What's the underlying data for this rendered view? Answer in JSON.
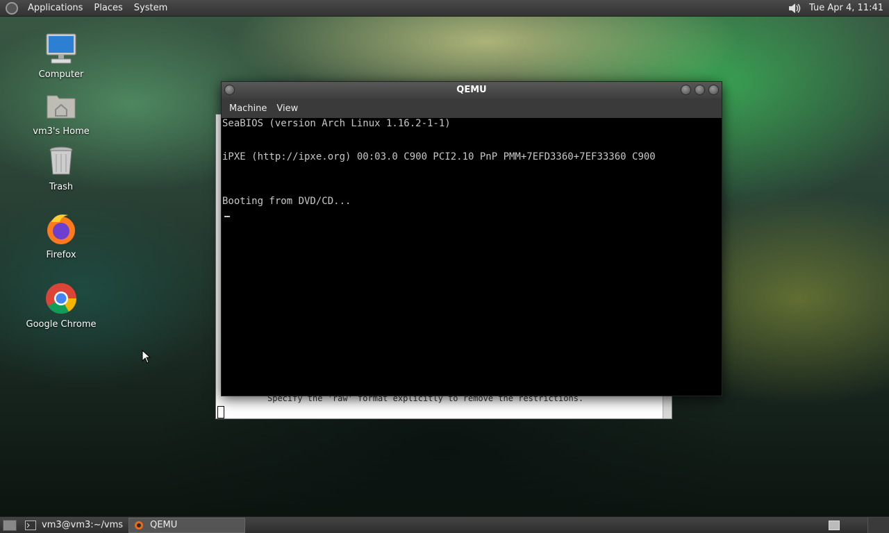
{
  "top_panel": {
    "menus": [
      "Applications",
      "Places",
      "System"
    ],
    "clock": "Tue Apr  4, 11:41",
    "volume_icon": "speaker-icon"
  },
  "desktop_icons": [
    {
      "label": "Computer",
      "icon": "computer-icon"
    },
    {
      "label": "vm3's Home",
      "icon": "home-folder-icon"
    },
    {
      "label": "Trash",
      "icon": "trash-icon"
    },
    {
      "label": "Firefox",
      "icon": "firefox-icon"
    },
    {
      "label": "Google Chrome",
      "icon": "chrome-icon"
    }
  ],
  "terminal": {
    "visible_text": "Specify the 'raw' format explicitly to remove the restrictions."
  },
  "qemu": {
    "title": "QEMU",
    "menus": [
      "Machine",
      "View"
    ],
    "screen_lines": [
      "SeaBIOS (version Arch Linux 1.16.2-1-1)",
      "iPXE (http://ipxe.org) 00:03.0 C900 PCI2.10 PnP PMM+7EFD3360+7EF33360 C900",
      "Booting from DVD/CD..."
    ]
  },
  "bottom_panel": {
    "tasks": [
      {
        "label": "vm3@vm3:~/vms",
        "icon": "terminal-icon",
        "active": false
      },
      {
        "label": "QEMU",
        "icon": "qemu-icon",
        "active": true
      }
    ]
  }
}
